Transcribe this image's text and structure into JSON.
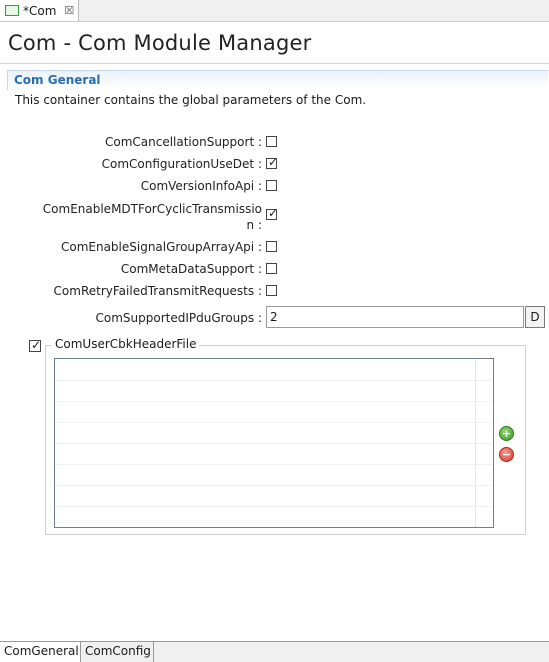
{
  "editor_tab": {
    "title": "*Com",
    "close_glyph": "☒",
    "icon": "file-icon"
  },
  "page": {
    "title": "Com - Com Module Manager"
  },
  "section": {
    "title": "Com General",
    "description": "This container contains the global parameters of the Com."
  },
  "fields": [
    {
      "label": "ComCancellationSupport :",
      "checked": false
    },
    {
      "label": "ComConfigurationUseDet :",
      "checked": true
    },
    {
      "label": "ComVersionInfoApi :",
      "checked": false
    },
    {
      "label_line1": "ComEnableMDTForCyclicTransmissio",
      "label_line2": "n :",
      "checked": true
    },
    {
      "label": "ComEnableSignalGroupArrayApi :",
      "checked": false
    },
    {
      "label": "ComMetaDataSupport :",
      "checked": false
    },
    {
      "label": "ComRetryFailedTransmitRequests :",
      "checked": false
    }
  ],
  "ipdu_groups": {
    "label": "ComSupportedIPduGroups :",
    "value": "2",
    "button_label": "D"
  },
  "group": {
    "label": "ComUserCbkHeaderFile",
    "checked": true
  },
  "group_actions": {
    "add_icon": "add-icon",
    "remove_icon": "remove-icon"
  },
  "bottom_tabs": [
    {
      "label": "ComGeneral",
      "active": true
    },
    {
      "label": "ComConfig",
      "active": false
    }
  ],
  "check_glyph": "✓"
}
